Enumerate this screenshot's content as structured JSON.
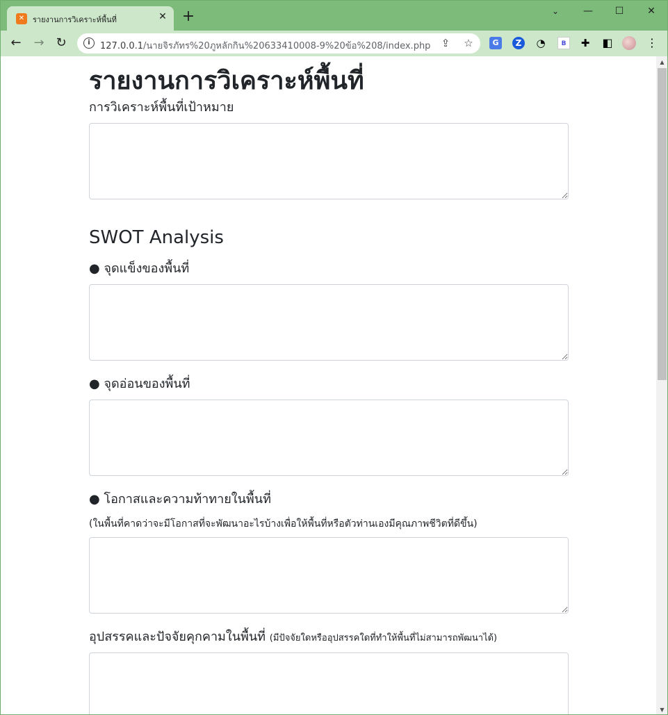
{
  "browser": {
    "tab": {
      "title": "รายงานการวิเคราะห์พื้นที่",
      "favicon_icon": "xampp-icon"
    },
    "window_controls": {
      "minimize": "—",
      "maximize": "☐",
      "close": "✕"
    },
    "address": {
      "host": "127.0.0.1",
      "path": "/นายจิรภัทร%20ภูหลักกิน%20633410008-9%20ข้อ%208/index.php"
    },
    "icons": {
      "back": "←",
      "forward": "→",
      "reload": "↻",
      "share": "⇪",
      "bookmark": "☆",
      "new_tab": "+",
      "tab_close": "✕",
      "ext_translate": "G",
      "ext_z": "Z",
      "ext_speed": "◔",
      "ext_b": "B",
      "ext_puzzle": "✚",
      "side_panel": "◧",
      "menu": "⋮"
    }
  },
  "page": {
    "title": "รายงานการวิเคราะห์พื้นที่",
    "target_label": "การวิเคราะห์พื้นที่เป้าหมาย",
    "swot_heading": "SWOT Analysis",
    "strengths_label": "● จุดแข็งของพื้นที่",
    "weaknesses_label": "● จุดอ่อนของพื้นที่",
    "opportunities_label": "● โอกาสและความท้าทายในพื้นที่",
    "opportunities_hint": "(ในพื้นที่คาดว่าจะมีโอกาสที่จะพัฒนาอะไรบ้างเพื่อให้พื้นที่หรือตัวท่านเองมีคุณภาพชีวิตที่ดีขึ้น)",
    "threats_label": "อุปสรรคและปัจจัยคุกคามในพื้นที่",
    "threats_hint": "(มีปัจจัยใดหรืออุปสรรคใดที่ทำให้พื้นที่ไม่สามารถพัฒนาได้)",
    "fields": {
      "target": "",
      "strengths": "",
      "weaknesses": "",
      "opportunities": "",
      "threats": ""
    }
  }
}
